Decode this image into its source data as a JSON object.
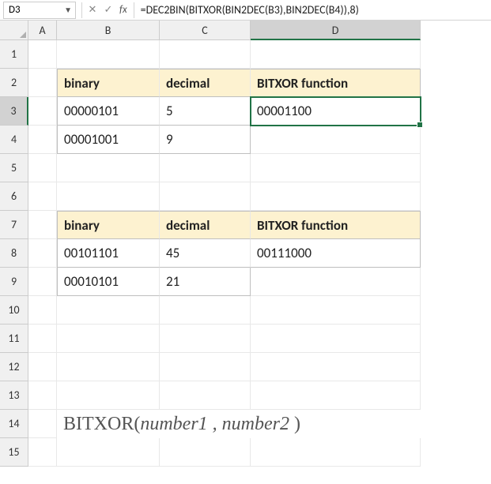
{
  "formula_bar": {
    "cell_ref": "D3",
    "fx_label": "fx",
    "formula": "=DEC2BIN(BITXOR(BIN2DEC(B3),BIN2DEC(B4)),8)"
  },
  "columns": {
    "A": "A",
    "B": "B",
    "C": "C",
    "D": "D"
  },
  "rows": [
    "1",
    "2",
    "3",
    "4",
    "5",
    "6",
    "7",
    "8",
    "9",
    "10",
    "11",
    "12",
    "13",
    "14",
    "15"
  ],
  "table1": {
    "headers": {
      "binary": "binary",
      "decimal": "decimal",
      "bitxor": "BITXOR function"
    },
    "rows": [
      {
        "binary": "00000101",
        "decimal": "5",
        "result": "00001100"
      },
      {
        "binary": "00001001",
        "decimal": "9",
        "result": ""
      }
    ]
  },
  "table2": {
    "headers": {
      "binary": "binary",
      "decimal": "decimal",
      "bitxor": "BITXOR function"
    },
    "rows": [
      {
        "binary": "00101101",
        "decimal": "45",
        "result": "00111000"
      },
      {
        "binary": "00010101",
        "decimal": "21",
        "result": ""
      }
    ]
  },
  "syntax": {
    "fn": "BITXOR(",
    "args": "number1 , number2 ",
    "close": ")"
  }
}
